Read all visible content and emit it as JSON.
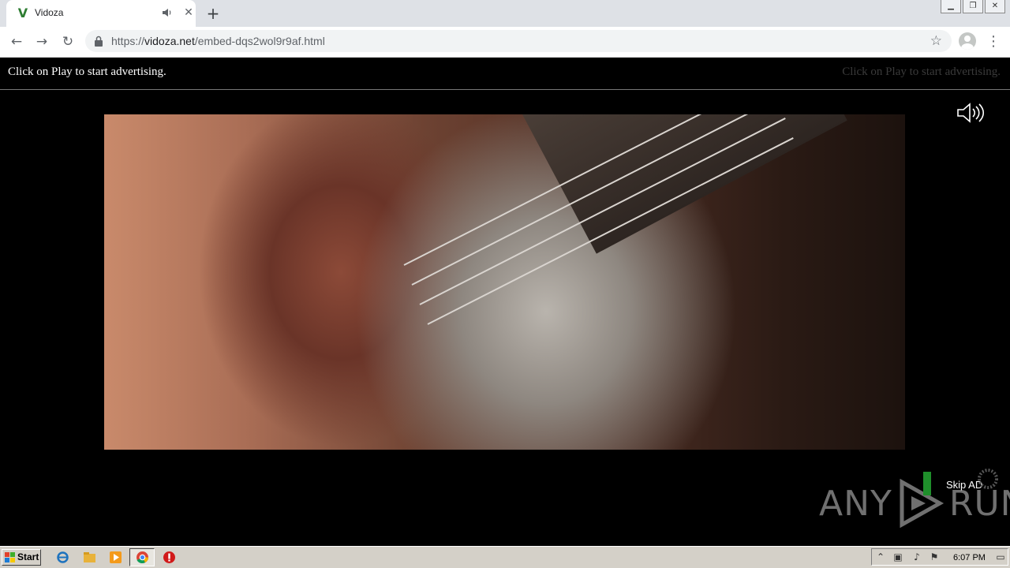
{
  "browser": {
    "tab": {
      "title": "Vidoza",
      "favicon": "V"
    },
    "url": {
      "scheme": "https://",
      "host": "vidoza.net",
      "path": "/embed-dqs2wol9r9af.html"
    },
    "icons": [
      "back-icon",
      "forward-icon",
      "reload-icon",
      "lock-icon",
      "star-icon",
      "profile-icon",
      "menu-icon",
      "audio-icon",
      "close-icon",
      "new-tab-icon"
    ]
  },
  "page": {
    "ad_banner": {
      "left_text": "Click on Play to start advertising.",
      "right_text": "Click on Play to start advertising."
    },
    "skip": {
      "label": "Skip AD"
    },
    "watermark": {
      "left": "ANY",
      "right": "RUN"
    }
  },
  "taskbar": {
    "start_label": "Start",
    "clock": "6:07 PM"
  },
  "colors": {
    "skip_bar": "#1f8f2b",
    "chrome_bg": "#dee1e6",
    "taskbar_bg": "#d4d0c8"
  }
}
